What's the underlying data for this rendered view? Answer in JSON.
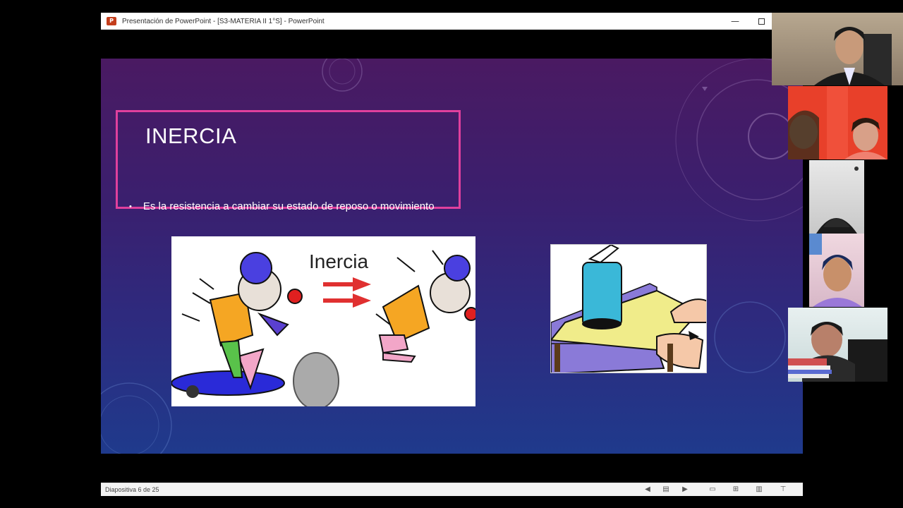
{
  "window": {
    "title": "Presentación de PowerPoint - [S3-MATERIA II 1°S] - PowerPoint",
    "app_icon": "P",
    "minimize_glyph": "—"
  },
  "slide": {
    "title": "INERCIA",
    "bullet_text": "Es la resistencia a cambiar su estado de reposo o movimiento",
    "image1_label": "Inercia"
  },
  "statusbar": {
    "slide_counter": "Diapositiva 6 de 25",
    "icons": [
      "previous-slide-icon",
      "slide-menu-icon",
      "next-slide-icon",
      "normal-view-icon",
      "slide-sorter-icon",
      "reading-view-icon",
      "slideshow-icon"
    ]
  },
  "participants": [
    {
      "name": "participant-1"
    },
    {
      "name": "participant-2"
    },
    {
      "name": "participant-3"
    },
    {
      "name": "participant-4"
    },
    {
      "name": "participant-5"
    }
  ],
  "colors": {
    "title_box_border": "#e0409d",
    "ppt_icon": "#c43e1c"
  }
}
